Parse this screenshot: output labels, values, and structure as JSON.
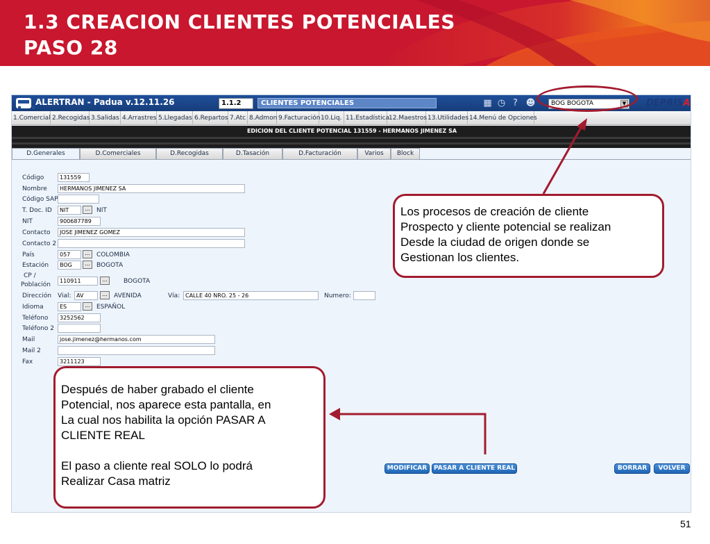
{
  "slide": {
    "title_line1": "1.3 CREACION CLIENTES POTENCIALES",
    "title_line2": "PASO 28",
    "page_number": "51"
  },
  "app": {
    "title": "ALERTRAN - Padua  v.12.11.26",
    "code": "1.1.2",
    "module": "CLIENTES POTENCIALES",
    "city_selected": "BOG BOGOTA",
    "logo_main": "DEPRIS",
    "logo_accent": "A",
    "icons": [
      "calendar-icon",
      "clock-icon",
      "help-icon",
      "user-icon"
    ],
    "menu": [
      "1.Comercial",
      "2.Recogidas",
      "3.Salidas",
      "4.Arrastres",
      "5.Llegadas",
      "6.Repartos",
      "7.Atc",
      "8.Admon",
      "9.Facturación",
      "10.Liq.",
      "11.Estadística",
      "12.Maestros",
      "13.Utilidades",
      "14.Menú de Opciones"
    ],
    "edit_title": "EDICION DEL CLIENTE POTENCIAL 131559 - HERMANOS JIMENEZ SA",
    "tabs": [
      "D.Generales",
      "D.Comerciales",
      "D.Recogidas",
      "D.Tasación",
      "D.Facturación",
      "Varios",
      "Block"
    ],
    "form": {
      "codigo_label": "Código",
      "codigo": "131559",
      "nombre_label": "Nombre",
      "nombre": "HERMANOS JIMENEZ SA",
      "codigo_sap_label": "Código SAP",
      "codigo_sap": "",
      "tdoc_label": "T. Doc. ID",
      "tdoc": "NIT",
      "tdoc_desc": "NIT",
      "nit_label": "NIT",
      "nit": "900687789",
      "contacto_label": "Contacto",
      "contacto": "JOSE JIMENEZ GOMEZ",
      "contacto2_label": "Contacto 2",
      "contacto2": "",
      "pais_label": "País",
      "pais": "057",
      "pais_desc": "COLOMBIA",
      "estacion_label": "Estación",
      "estacion": "BOG",
      "estacion_desc": "BOGOTA",
      "cp_label_1": "CP /",
      "cp_label_2": "Población",
      "cp": "110911",
      "cp_desc": "BOGOTA",
      "direccion_label": "Dirección",
      "vial_label": "Vial:",
      "vial": "AV",
      "vial_desc": "AVENIDA",
      "via_label": "Vía:",
      "via": "CALLE 40 NRO. 25 - 26",
      "numero_label": "Numero:",
      "numero": "",
      "idioma_label": "Idioma",
      "idioma": "ES",
      "idioma_desc": "ESPAÑOL",
      "telefono_label": "Teléfono",
      "telefono": "3252562",
      "telefono2_label": "Teléfono 2",
      "telefono2": "",
      "mail_label": "Mail",
      "mail": "jose.jimenez@hermanos.com",
      "mail2_label": "Mail 2",
      "mail2": "",
      "fax_label": "Fax",
      "fax": "3211123",
      "lookup_label": "..."
    },
    "buttons": {
      "modificar": "MODIFICAR",
      "pasar": "PASAR A CLIENTE REAL",
      "borrar": "BORRAR",
      "volver": "VOLVER"
    }
  },
  "callouts": {
    "top": [
      "Los procesos de creación de cliente",
      "Prospecto y cliente potencial se realizan",
      "Desde la ciudad  de origen donde se",
      "Gestionan los clientes."
    ],
    "bottom": [
      "Después de haber grabado el cliente",
      "Potencial, nos aparece esta pantalla, en",
      "La cual nos habilita la opción PASAR A",
      "CLIENTE REAL",
      "",
      "El paso a cliente real SOLO lo podrá",
      "Realizar Casa matriz"
    ]
  },
  "colors": {
    "banner_red": "#c8172e",
    "banner_orange": "#f07a1a",
    "callout_border": "#a21b2e",
    "app_titlebar": "#1f4f99",
    "button_blue": "#1d64b5"
  }
}
